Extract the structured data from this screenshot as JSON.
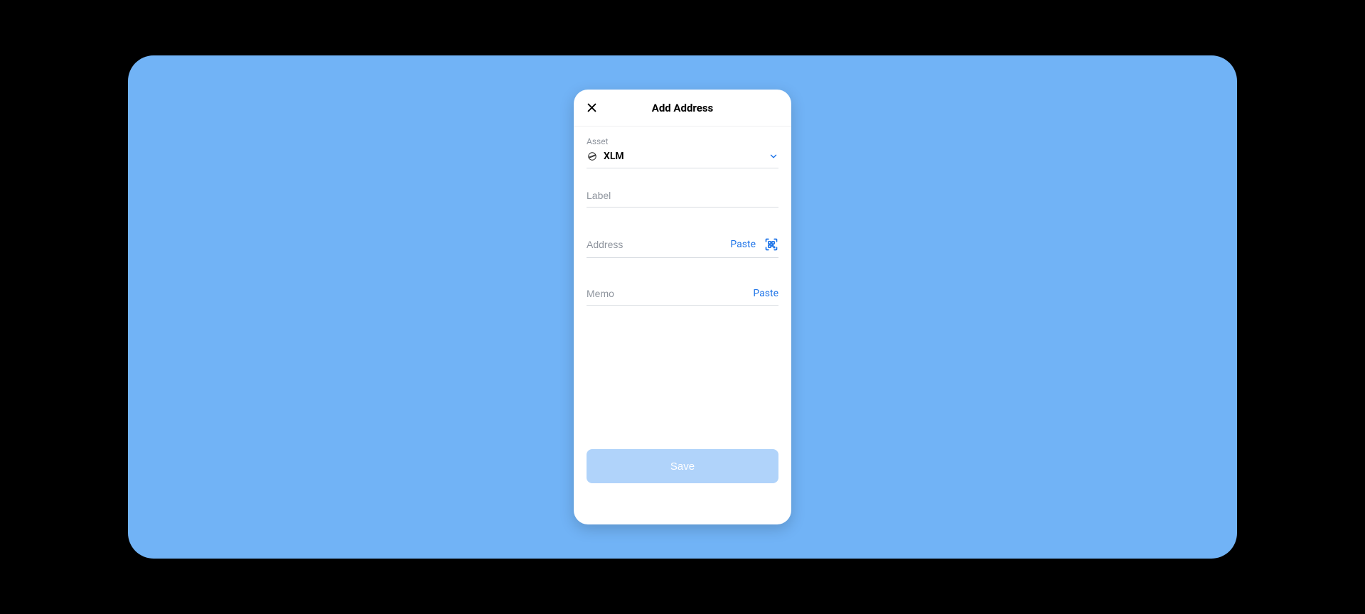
{
  "header": {
    "title": "Add Address"
  },
  "asset": {
    "label": "Asset",
    "selected": "XLM"
  },
  "label_field": {
    "placeholder": "Label",
    "value": ""
  },
  "address_field": {
    "placeholder": "Address",
    "value": "",
    "paste_label": "Paste"
  },
  "memo_field": {
    "placeholder": "Memo",
    "value": "",
    "paste_label": "Paste"
  },
  "save_button": {
    "label": "Save"
  },
  "colors": {
    "accent": "#1e74e8",
    "background": "#71b3f6",
    "save_disabled_bg": "#b0d3fa"
  }
}
